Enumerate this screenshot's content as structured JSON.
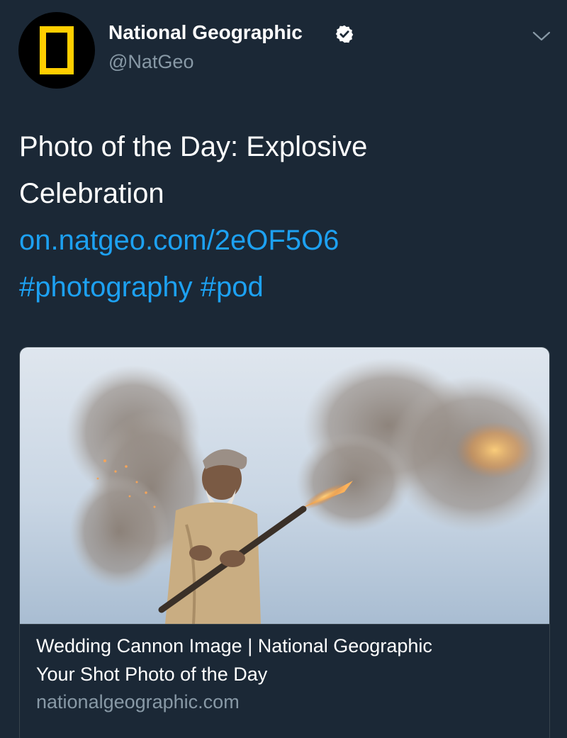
{
  "author": {
    "display_name": "National Geographic",
    "handle": "@NatGeo",
    "verified": true,
    "avatar_icon": "national-geographic-logo",
    "brand_color": "#ffce00"
  },
  "menu_icon": "chevron-down-icon",
  "tweet": {
    "text_line1": "Photo of the Day: Explosive",
    "text_line2": "Celebration",
    "link": "on.natgeo.com/2eOF5O6",
    "hashtag1": "#photography",
    "hashtag2": "#pod"
  },
  "card": {
    "image_icon": "photo-man-firing-cannon-smoke",
    "title_line1": "Wedding Cannon Image | National Geographic",
    "title_line2": "Your Shot Photo of the Day",
    "domain": "nationalgeographic.com"
  },
  "colors": {
    "background": "#1b2836",
    "link": "#1da1f2",
    "secondary_text": "#8899a6"
  }
}
